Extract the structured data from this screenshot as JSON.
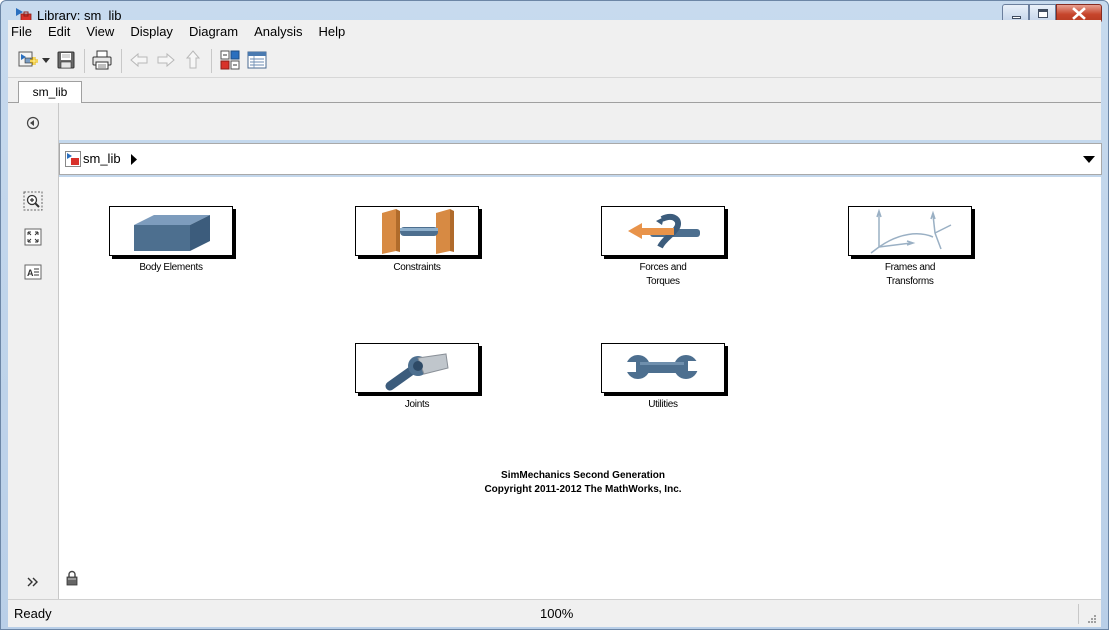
{
  "window": {
    "title": "Library: sm_lib"
  },
  "menu": [
    "File",
    "Edit",
    "View",
    "Display",
    "Diagram",
    "Analysis",
    "Help"
  ],
  "tab": {
    "label": "sm_lib"
  },
  "address": {
    "path": "sm_lib"
  },
  "blocks": [
    {
      "label_line1": "Body Elements",
      "label_line2": "",
      "icon": "body-elements-icon"
    },
    {
      "label_line1": "Constraints",
      "label_line2": "",
      "icon": "constraints-icon"
    },
    {
      "label_line1": "Forces and",
      "label_line2": "Torques",
      "icon": "forces-torques-icon"
    },
    {
      "label_line1": "Frames and",
      "label_line2": "Transforms",
      "icon": "frames-transforms-icon"
    },
    {
      "label_line1": "Joints",
      "label_line2": "",
      "icon": "joints-icon"
    },
    {
      "label_line1": "Utilities",
      "label_line2": "",
      "icon": "utilities-icon"
    }
  ],
  "copyright": {
    "line1": "SimMechanics Second Generation",
    "line2": "Copyright 2011-2012 The MathWorks, Inc."
  },
  "status": {
    "text": "Ready",
    "zoom": "100%"
  },
  "colors": {
    "close_button": "#c6452c",
    "block_body": "#4d6f8f",
    "block_orange": "#e8934a"
  }
}
